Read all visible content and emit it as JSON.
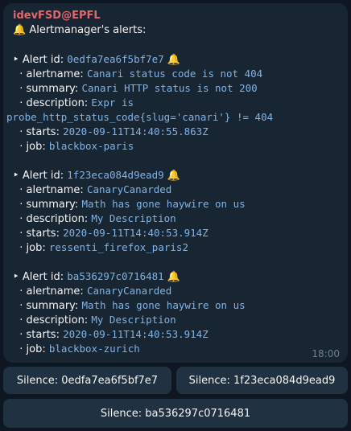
{
  "message": {
    "sender": "idevFSD@EPFL",
    "header_text": "Alertmanager's alerts:",
    "time": "18:00",
    "alerts": [
      {
        "id_label": "Alert id:",
        "id": "0edfa7ea6f5bf7e7",
        "alertname": "Canari status code is not 404",
        "summary": "Canari HTTP status is not 200",
        "description_line1": "Expr is",
        "description_line2": "probe_http_status_code{slug='canari'} != 404",
        "starts": "2020-09-11T14:40:55.863Z",
        "job": "blackbox-paris"
      },
      {
        "id_label": "Alert id:",
        "id": "1f23eca084d9ead9",
        "alertname": "CanaryCanarded",
        "summary": "Math has gone haywire on us",
        "description_line1": "My Description",
        "starts": "2020-09-11T14:40:53.914Z",
        "job": "ressenti_firefox_paris2"
      },
      {
        "id_label": "Alert id:",
        "id": "ba536297c0716481",
        "alertname": "CanaryCanarded",
        "summary": "Math has gone haywire on us",
        "description_line1": "My Description",
        "starts": "2020-09-11T14:40:53.914Z",
        "job": "blackbox-zurich"
      }
    ],
    "labels": {
      "alertname": "alertname:",
      "summary": "summary:",
      "description": "description:",
      "starts": "starts:",
      "job": "job:"
    }
  },
  "buttons": {
    "silence1": "Silence: 0edfa7ea6f5bf7e7",
    "silence2": "Silence: 1f23eca084d9ead9",
    "silence3": "Silence: ba536297c0716481"
  },
  "icons": {
    "bell": "bell-icon"
  },
  "colors": {
    "sender": "#e2686b",
    "code": "#7fb4e8",
    "bubble": "#182533",
    "background": "#0e1621"
  }
}
